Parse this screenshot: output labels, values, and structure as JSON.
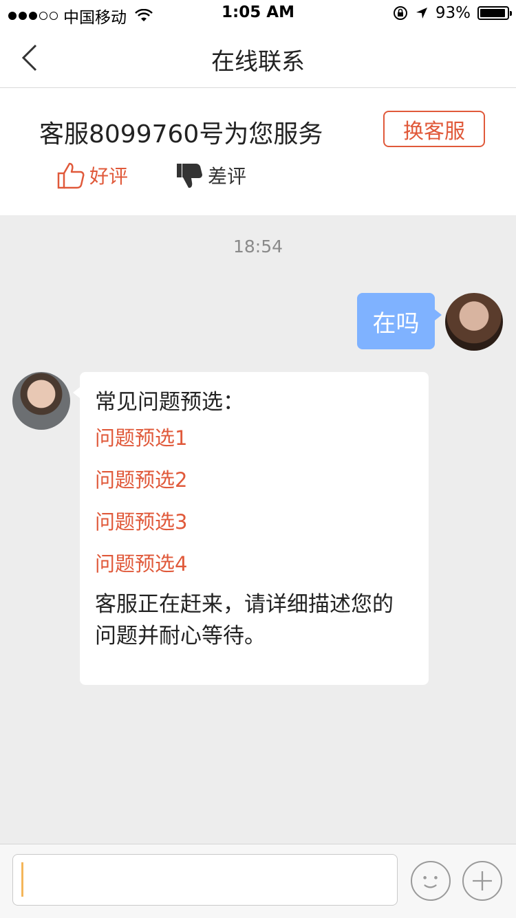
{
  "status_bar": {
    "carrier": "中国移动",
    "time": "1:05 AM",
    "battery": "93%"
  },
  "nav": {
    "title": "在线联系"
  },
  "service": {
    "title": "客服8099760号为您服务",
    "switch_label": "换客服",
    "good_label": "好评",
    "bad_label": "差评"
  },
  "chat": {
    "timestamp": "18:54",
    "user_message": "在吗",
    "agent": {
      "heading": "常见问题预选：",
      "options": [
        "问题预选1",
        "问题预选2",
        "问题预选3",
        "问题预选4"
      ],
      "note": "客服正在赶来，请详细描述您的问题并耐心等待。"
    }
  },
  "colors": {
    "accent": "#e0593a",
    "user_bubble": "#7fb2ff",
    "background": "#ededed"
  }
}
